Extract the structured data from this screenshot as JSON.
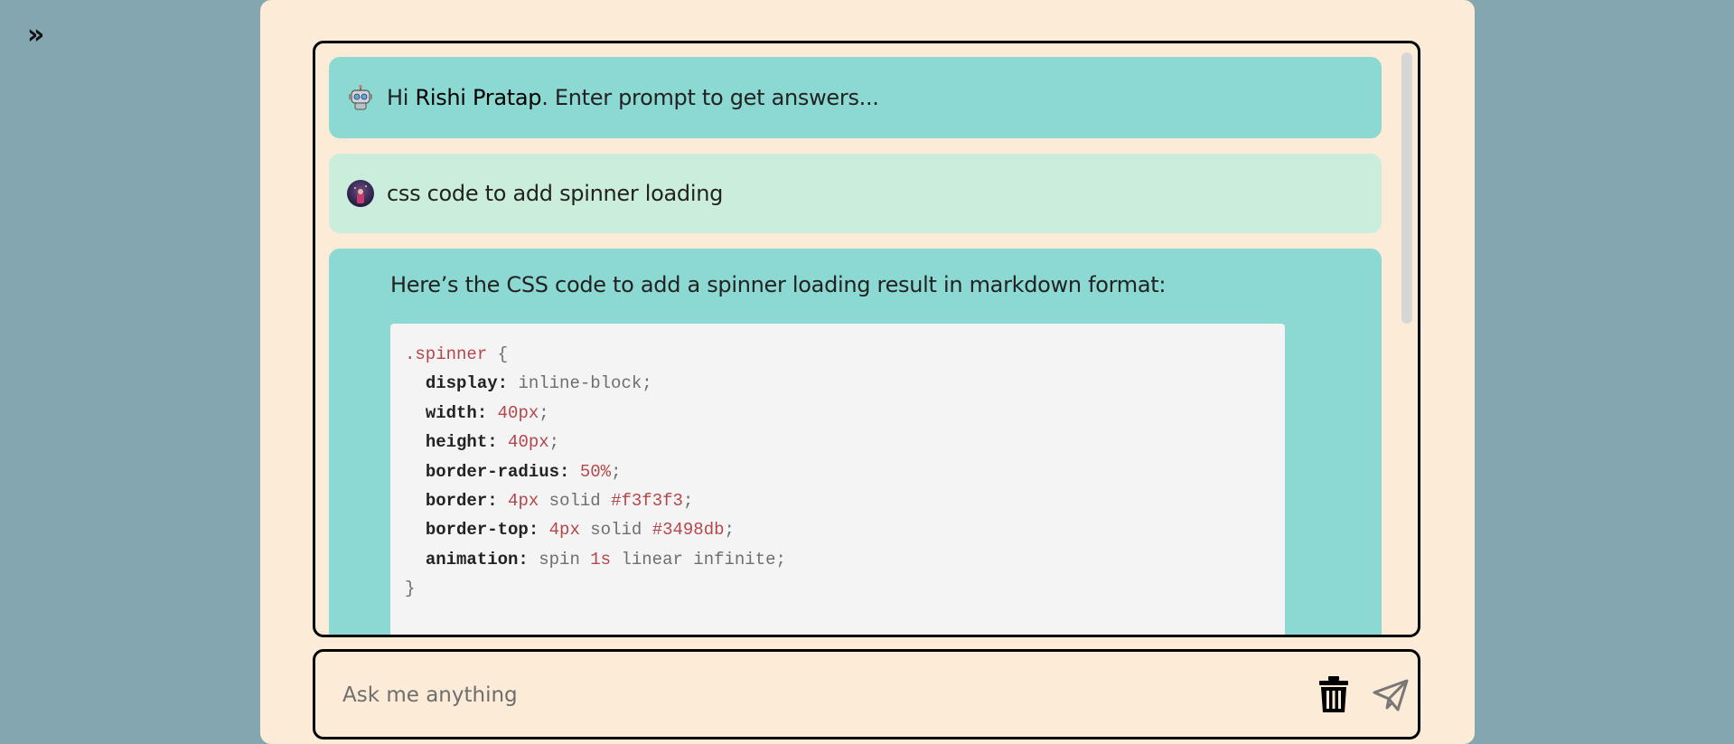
{
  "sidebar": {
    "expand_label": "»"
  },
  "chat": {
    "greeting": {
      "prefix": "Hi ",
      "name": "Rishi Pratap",
      "suffix": ". Enter prompt to get answers..."
    },
    "user_message": "css code to add spinner loading",
    "answer": {
      "intro": "Here’s the CSS code to add a spinner loading result in markdown format:",
      "code": {
        "selector": ".spinner",
        "open": " {",
        "close": "}",
        "declarations": [
          {
            "prop": "display",
            "parts": [
              {
                "t": "inline-block",
                "num": false
              }
            ]
          },
          {
            "prop": "width",
            "parts": [
              {
                "t": "40px",
                "num": true
              }
            ]
          },
          {
            "prop": "height",
            "parts": [
              {
                "t": "40px",
                "num": true
              }
            ]
          },
          {
            "prop": "border-radius",
            "parts": [
              {
                "t": "50%",
                "num": true
              }
            ]
          },
          {
            "prop": "border",
            "parts": [
              {
                "t": "4px",
                "num": true
              },
              {
                "t": " solid ",
                "num": false
              },
              {
                "t": "#f3f3f3",
                "num": true
              }
            ]
          },
          {
            "prop": "border-top",
            "parts": [
              {
                "t": "4px",
                "num": true
              },
              {
                "t": " solid ",
                "num": false
              },
              {
                "t": "#3498db",
                "num": true
              }
            ]
          },
          {
            "prop": "animation",
            "parts": [
              {
                "t": "spin ",
                "num": false
              },
              {
                "t": "1s",
                "num": true
              },
              {
                "t": " linear infinite",
                "num": false
              }
            ]
          }
        ]
      }
    }
  },
  "input": {
    "placeholder": "Ask me anything"
  },
  "icons": {
    "expand": "double-chevron-right-icon",
    "bot_avatar": "robot-avatar-icon",
    "user_avatar": "user-avatar-icon",
    "clear": "trash-icon",
    "send": "paper-plane-icon"
  },
  "colors": {
    "background": "#84a6b0",
    "panel": "#fcebd6",
    "bot_bubble": "#8cd8d2",
    "user_bubble": "#cbeedc",
    "code_bg": "#f4f4f4",
    "code_number": "#b3474b"
  }
}
